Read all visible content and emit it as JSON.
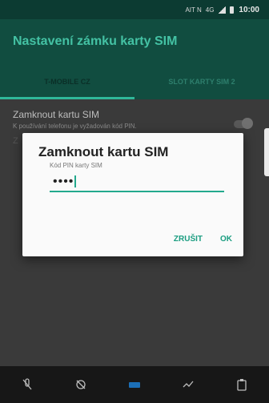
{
  "status_bar": {
    "carrier_glyphs": "AIT N",
    "network": "4G",
    "time": "10:00"
  },
  "app_bar": {
    "title": "Nastavení zámku karty SIM"
  },
  "tabs": [
    {
      "label": "T-MOBILE CZ",
      "active": true
    },
    {
      "label": "SLOT KARTY SIM 2",
      "active": false
    }
  ],
  "setting": {
    "title": "Zamknout kartu SIM",
    "summary": "K používání telefonu je vyžadován kód PIN.",
    "toggle_on": false
  },
  "dialog": {
    "title": "Zamknout kartu SIM",
    "label": "Kód PIN karty SIM",
    "pin_value": "••••",
    "cancel_label": "ZRUŠIT",
    "ok_label": "OK"
  },
  "nav_bar": {
    "icons": [
      "mute-mic-icon",
      "no-camera-icon",
      "keyboard-icon",
      "shortcut-icon",
      "clipboard-icon"
    ]
  },
  "colors": {
    "app_bar": "#114d40",
    "accent": "#23a98d",
    "title_text": "#44c2a4"
  }
}
